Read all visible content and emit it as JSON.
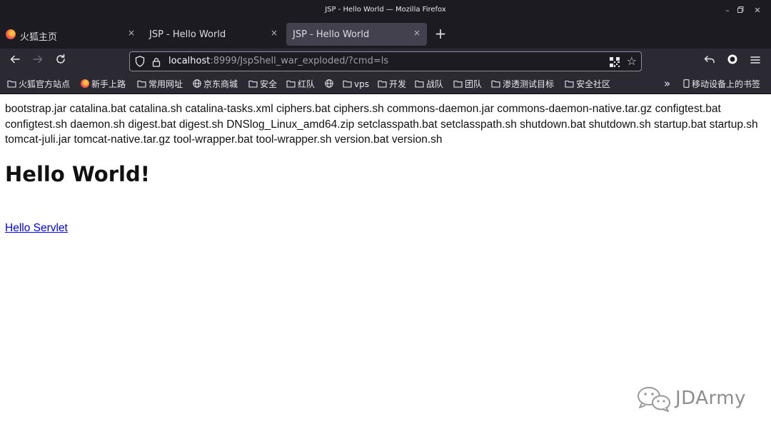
{
  "window": {
    "title": "JSP - Hello World — Mozilla Firefox"
  },
  "tabs": [
    {
      "label": "火狐主页",
      "icon": "firefox-logo-icon",
      "active": false
    },
    {
      "label": "JSP - Hello World",
      "active": false
    },
    {
      "label": "JSP - Hello World",
      "active": true
    }
  ],
  "tab_close_glyph": "×",
  "new_tab_glyph": "+",
  "urlbar": {
    "host": "localhost",
    "path": ":8999/JspShell_war_exploded/?cmd=ls"
  },
  "bookmarks": [
    {
      "label": "火狐官方站点",
      "icon": "folder-icon"
    },
    {
      "label": "新手上路",
      "icon": "firefox-logo-icon"
    },
    {
      "label": "常用网址",
      "icon": "folder-icon"
    },
    {
      "label": "京东商城",
      "icon": "globe-icon"
    },
    {
      "label": "安全",
      "icon": "folder-icon"
    },
    {
      "label": "红队",
      "icon": "folder-icon"
    },
    {
      "label": "",
      "icon": "globe-icon"
    },
    {
      "label": "vps",
      "icon": "folder-icon"
    },
    {
      "label": "开发",
      "icon": "folder-icon"
    },
    {
      "label": "战队",
      "icon": "folder-icon"
    },
    {
      "label": "团队",
      "icon": "folder-icon"
    },
    {
      "label": "渗透测试目标",
      "icon": "folder-icon"
    },
    {
      "label": "安全社区",
      "icon": "folder-icon"
    }
  ],
  "bookmarks_overflow_glyph": "»",
  "mobile_bookmarks": "移动设备上的书签",
  "page": {
    "listing": "bootstrap.jar catalina.bat catalina.sh catalina-tasks.xml ciphers.bat ciphers.sh commons-daemon.jar commons-daemon-native.tar.gz configtest.bat configtest.sh daemon.sh digest.bat digest.sh DNSlog_Linux_amd64.zip setclasspath.bat setclasspath.sh shutdown.bat shutdown.sh startup.bat startup.sh tomcat-juli.jar tomcat-native.tar.gz tool-wrapper.bat tool-wrapper.sh version.bat version.sh",
    "heading": "Hello World!",
    "link": "Hello Servlet"
  },
  "watermark": "JDArmy",
  "colors": {
    "chrome_dark": "#1c1b22",
    "toolbar": "#2b2a33",
    "active_tab": "#42414d",
    "link": "#0000ee"
  }
}
